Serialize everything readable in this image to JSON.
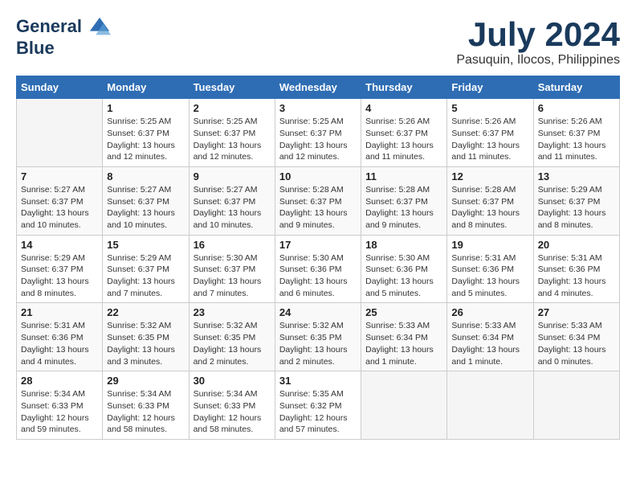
{
  "header": {
    "logo_line1": "General",
    "logo_line2": "Blue",
    "month_title": "July 2024",
    "location": "Pasuquin, Ilocos, Philippines"
  },
  "weekdays": [
    "Sunday",
    "Monday",
    "Tuesday",
    "Wednesday",
    "Thursday",
    "Friday",
    "Saturday"
  ],
  "weeks": [
    [
      {
        "day": "",
        "info": ""
      },
      {
        "day": "1",
        "info": "Sunrise: 5:25 AM\nSunset: 6:37 PM\nDaylight: 13 hours\nand 12 minutes."
      },
      {
        "day": "2",
        "info": "Sunrise: 5:25 AM\nSunset: 6:37 PM\nDaylight: 13 hours\nand 12 minutes."
      },
      {
        "day": "3",
        "info": "Sunrise: 5:25 AM\nSunset: 6:37 PM\nDaylight: 13 hours\nand 12 minutes."
      },
      {
        "day": "4",
        "info": "Sunrise: 5:26 AM\nSunset: 6:37 PM\nDaylight: 13 hours\nand 11 minutes."
      },
      {
        "day": "5",
        "info": "Sunrise: 5:26 AM\nSunset: 6:37 PM\nDaylight: 13 hours\nand 11 minutes."
      },
      {
        "day": "6",
        "info": "Sunrise: 5:26 AM\nSunset: 6:37 PM\nDaylight: 13 hours\nand 11 minutes."
      }
    ],
    [
      {
        "day": "7",
        "info": "Sunrise: 5:27 AM\nSunset: 6:37 PM\nDaylight: 13 hours\nand 10 minutes."
      },
      {
        "day": "8",
        "info": "Sunrise: 5:27 AM\nSunset: 6:37 PM\nDaylight: 13 hours\nand 10 minutes."
      },
      {
        "day": "9",
        "info": "Sunrise: 5:27 AM\nSunset: 6:37 PM\nDaylight: 13 hours\nand 10 minutes."
      },
      {
        "day": "10",
        "info": "Sunrise: 5:28 AM\nSunset: 6:37 PM\nDaylight: 13 hours\nand 9 minutes."
      },
      {
        "day": "11",
        "info": "Sunrise: 5:28 AM\nSunset: 6:37 PM\nDaylight: 13 hours\nand 9 minutes."
      },
      {
        "day": "12",
        "info": "Sunrise: 5:28 AM\nSunset: 6:37 PM\nDaylight: 13 hours\nand 8 minutes."
      },
      {
        "day": "13",
        "info": "Sunrise: 5:29 AM\nSunset: 6:37 PM\nDaylight: 13 hours\nand 8 minutes."
      }
    ],
    [
      {
        "day": "14",
        "info": "Sunrise: 5:29 AM\nSunset: 6:37 PM\nDaylight: 13 hours\nand 8 minutes."
      },
      {
        "day": "15",
        "info": "Sunrise: 5:29 AM\nSunset: 6:37 PM\nDaylight: 13 hours\nand 7 minutes."
      },
      {
        "day": "16",
        "info": "Sunrise: 5:30 AM\nSunset: 6:37 PM\nDaylight: 13 hours\nand 7 minutes."
      },
      {
        "day": "17",
        "info": "Sunrise: 5:30 AM\nSunset: 6:36 PM\nDaylight: 13 hours\nand 6 minutes."
      },
      {
        "day": "18",
        "info": "Sunrise: 5:30 AM\nSunset: 6:36 PM\nDaylight: 13 hours\nand 5 minutes."
      },
      {
        "day": "19",
        "info": "Sunrise: 5:31 AM\nSunset: 6:36 PM\nDaylight: 13 hours\nand 5 minutes."
      },
      {
        "day": "20",
        "info": "Sunrise: 5:31 AM\nSunset: 6:36 PM\nDaylight: 13 hours\nand 4 minutes."
      }
    ],
    [
      {
        "day": "21",
        "info": "Sunrise: 5:31 AM\nSunset: 6:36 PM\nDaylight: 13 hours\nand 4 minutes."
      },
      {
        "day": "22",
        "info": "Sunrise: 5:32 AM\nSunset: 6:35 PM\nDaylight: 13 hours\nand 3 minutes."
      },
      {
        "day": "23",
        "info": "Sunrise: 5:32 AM\nSunset: 6:35 PM\nDaylight: 13 hours\nand 2 minutes."
      },
      {
        "day": "24",
        "info": "Sunrise: 5:32 AM\nSunset: 6:35 PM\nDaylight: 13 hours\nand 2 minutes."
      },
      {
        "day": "25",
        "info": "Sunrise: 5:33 AM\nSunset: 6:34 PM\nDaylight: 13 hours\nand 1 minute."
      },
      {
        "day": "26",
        "info": "Sunrise: 5:33 AM\nSunset: 6:34 PM\nDaylight: 13 hours\nand 1 minute."
      },
      {
        "day": "27",
        "info": "Sunrise: 5:33 AM\nSunset: 6:34 PM\nDaylight: 13 hours\nand 0 minutes."
      }
    ],
    [
      {
        "day": "28",
        "info": "Sunrise: 5:34 AM\nSunset: 6:33 PM\nDaylight: 12 hours\nand 59 minutes."
      },
      {
        "day": "29",
        "info": "Sunrise: 5:34 AM\nSunset: 6:33 PM\nDaylight: 12 hours\nand 58 minutes."
      },
      {
        "day": "30",
        "info": "Sunrise: 5:34 AM\nSunset: 6:33 PM\nDaylight: 12 hours\nand 58 minutes."
      },
      {
        "day": "31",
        "info": "Sunrise: 5:35 AM\nSunset: 6:32 PM\nDaylight: 12 hours\nand 57 minutes."
      },
      {
        "day": "",
        "info": ""
      },
      {
        "day": "",
        "info": ""
      },
      {
        "day": "",
        "info": ""
      }
    ]
  ]
}
